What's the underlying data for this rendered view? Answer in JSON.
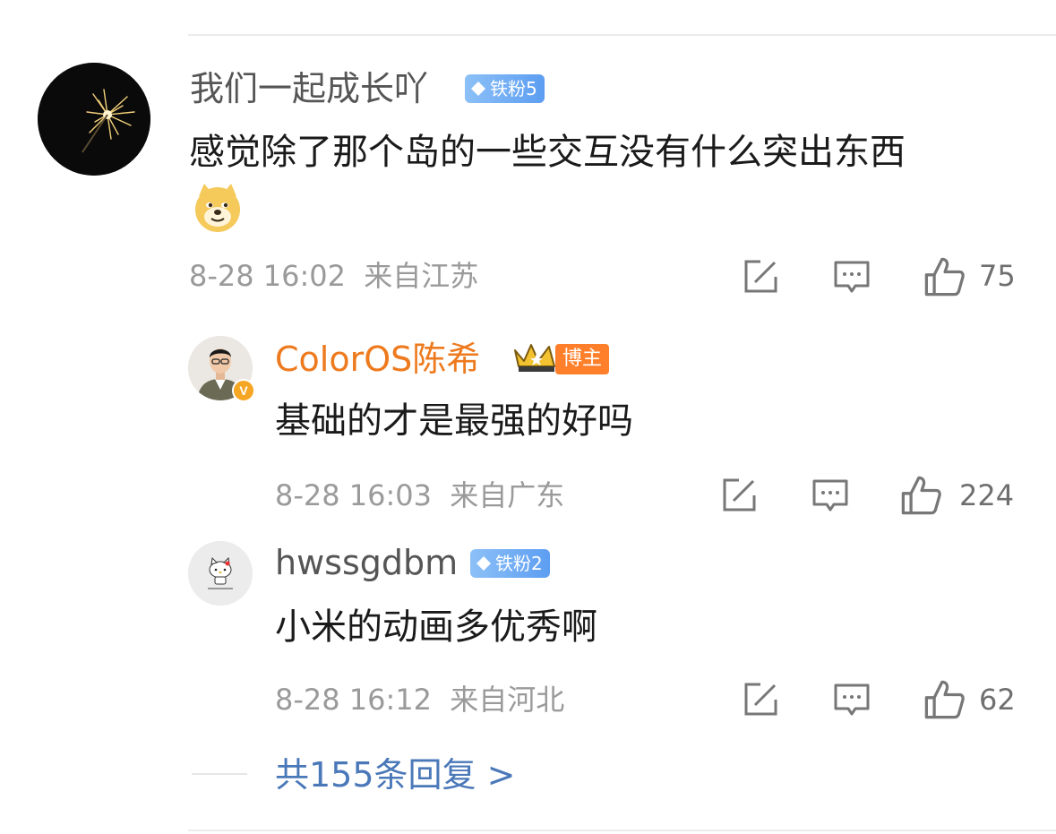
{
  "comment": {
    "username": "我们一起成长吖",
    "badge": "铁粉5",
    "text": "感觉除了那个岛的一些交互没有什么突出东西",
    "emoji": "doge-emoji",
    "time": "8-28 16:02",
    "location": "来自江苏",
    "likes": "75"
  },
  "replies": [
    {
      "username": "ColorOS陈希",
      "tag": "博主",
      "text": "基础的才是最强的好吗",
      "time": "8-28 16:03",
      "location": "来自广东",
      "likes": "224",
      "username_color": "#ee7a1e"
    },
    {
      "username": "hwssgdbm",
      "badge": "铁粉2",
      "text": "小米的动画多优秀啊",
      "time": "8-28 16:12",
      "location": "来自河北",
      "likes": "62"
    }
  ],
  "more_replies": "共155条回复 >",
  "icons": {
    "share": "share-icon",
    "comment": "comment-icon",
    "like": "thumbs-up-icon",
    "verified": "verified-badge-icon",
    "crown": "crown-icon"
  },
  "colors": {
    "link": "#4a78b8",
    "meta": "#9a9a9a",
    "badge": "#5d9ef2",
    "host_tag": "#ff7f2a"
  }
}
